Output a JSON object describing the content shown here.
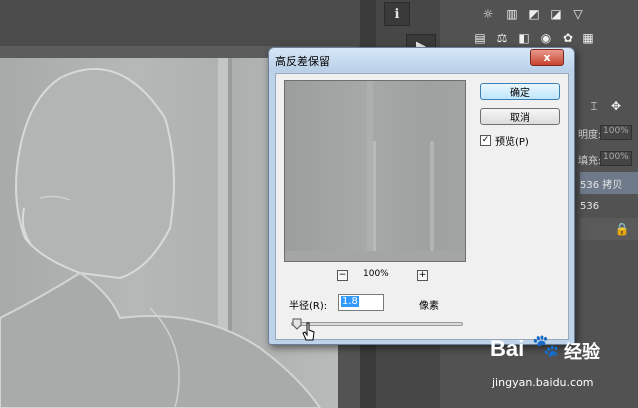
{
  "dialog": {
    "title": "高反差保留",
    "close_label": "x",
    "ok_label": "确定",
    "cancel_label": "取消",
    "preview_label": "预览(P)",
    "preview_checked": true,
    "zoom_level": "100%",
    "zoom_out_label": "−",
    "zoom_in_label": "+",
    "radius_label": "半径(R):",
    "radius_value": "1.8",
    "radius_unit": "像素"
  },
  "panel": {
    "opacity_label": "明度:",
    "opacity_value": "100%",
    "fill_label": "填充:",
    "fill_value": "100%",
    "layers": [
      "536 拷贝",
      "536"
    ]
  },
  "toolbar": {
    "info_icon": "info-icon",
    "play_icon": "play-icon"
  },
  "watermark": {
    "brand": "Bai",
    "brand_suffix": "经验",
    "url": "jingyan.baidu.com"
  }
}
